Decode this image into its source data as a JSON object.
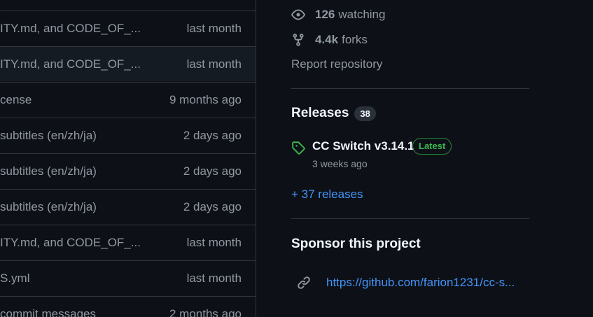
{
  "files": {
    "rows": [
      {
        "message": "ITY.md, and CODE_OF_...",
        "when": "last month"
      },
      {
        "message": "ITY.md, and CODE_OF_...",
        "when": "last month"
      },
      {
        "message": "cense",
        "when": "9 months ago"
      },
      {
        "message": "subtitles (en/zh/ja)",
        "when": "2 days ago"
      },
      {
        "message": "subtitles (en/zh/ja)",
        "when": "2 days ago"
      },
      {
        "message": "subtitles (en/zh/ja)",
        "when": "2 days ago"
      },
      {
        "message": "ITY.md, and CODE_OF_...",
        "when": "last month"
      },
      {
        "message": "S.yml",
        "when": "last month"
      },
      {
        "message": "commit messages",
        "when": "2 months ago"
      }
    ]
  },
  "sidebar": {
    "watching": {
      "count": "126",
      "label": "watching",
      "icon": "eye-icon"
    },
    "forks": {
      "count": "4.4k",
      "label": "forks",
      "icon": "fork-icon"
    },
    "report": "Report repository",
    "releases": {
      "title": "Releases",
      "count": "38",
      "latest": {
        "name": "CC Switch v3.14.1",
        "badge": "Latest",
        "date": "3 weeks ago",
        "icon": "tag-icon"
      },
      "more": "+ 37 releases"
    },
    "sponsor": {
      "title": "Sponsor this project",
      "url": "https://github.com/farion1231/cc-s...",
      "icon": "link-icon"
    }
  },
  "colors": {
    "background": "#0d1117",
    "border": "#30363d",
    "muted": "#9198a1",
    "accent": "#4493f8",
    "success": "#3fb950"
  }
}
